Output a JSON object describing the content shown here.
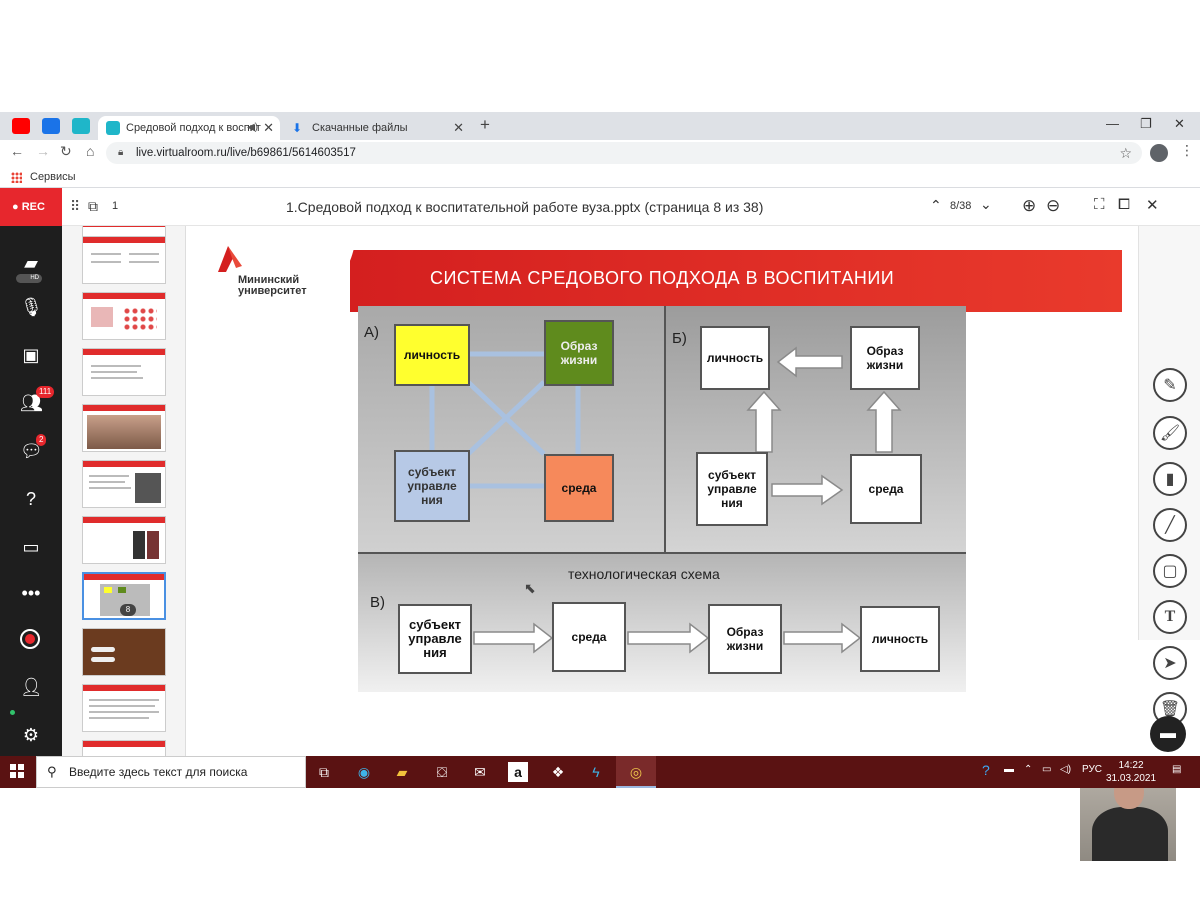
{
  "browser": {
    "tabs": [
      {
        "title": "Средовой подход к воспит",
        "active": true
      },
      {
        "title": "Скачанные файлы",
        "active": false
      }
    ],
    "url": "live.virtualroom.ru/live/b69861/5614603517",
    "bookmark_apps_label": "Сервисы"
  },
  "room": {
    "rec_label": "REC",
    "hd_label": "HD",
    "participants_count": "111",
    "chat_count": "2"
  },
  "viewer": {
    "layout_count": "1",
    "document_title": "1.Средовой подход к воспитательной работе вуза.pptx (страница 8 из 38)",
    "page_indicator": "8/38",
    "current_thumb_number": "8"
  },
  "slide": {
    "logo_line1": "Мининский",
    "logo_line2": "университет",
    "title": "СИСТЕМА СРЕДОВОГО ПОДХОДА  В ВОСПИТАНИИ",
    "panel_a": {
      "label": "А)",
      "box_lichnost": "личность",
      "box_obraz": "Образ жизни",
      "box_subject": "субъект управле ния",
      "box_sreda": "среда"
    },
    "panel_b": {
      "label": "Б)",
      "box_lichnost": "личность",
      "box_obraz": "Образ жизни",
      "box_subject": "субъект управле ния",
      "box_sreda": "среда"
    },
    "panel_c": {
      "label": "В)",
      "title": "технологическая  схема",
      "box_subject": "субъект управле ния",
      "box_sreda": "среда",
      "box_obraz": "Образ жизни",
      "box_lichnost": "личность"
    }
  },
  "taskbar": {
    "search_placeholder": "Введите здесь текст для поиска",
    "lang": "РУС",
    "time": "14:22",
    "date": "31.03.2021"
  },
  "colors": {
    "rec_red": "#e7272d",
    "slide_band": "#d41f1f",
    "taskbar": "#5a1212",
    "box_yellow": "#ffff2e",
    "box_green": "#5f8b1d",
    "box_blue": "#b7c9e6",
    "box_orange": "#f6895b"
  }
}
